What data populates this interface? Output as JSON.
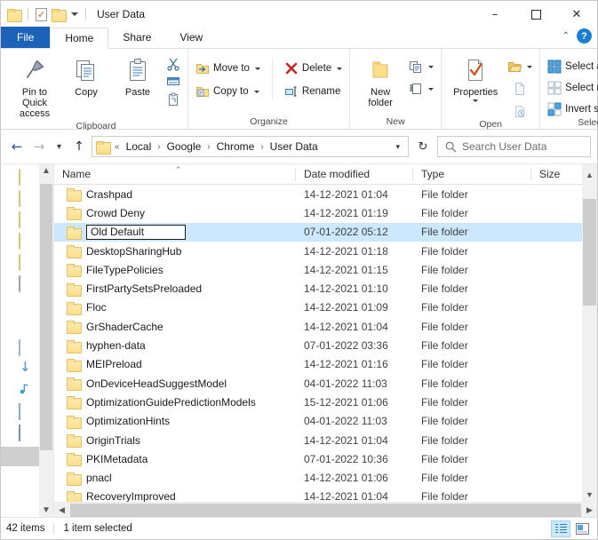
{
  "window": {
    "title": "User Data",
    "minimize_label": "–",
    "maximize_label": "☐",
    "close_label": "✕"
  },
  "quick_access_toolbar": {
    "items": [
      {
        "icon": "folder-icon",
        "name": "explorer-window-icon"
      },
      {
        "icon": "properties-icon",
        "name": "qat-properties"
      },
      {
        "icon": "new-folder-icon",
        "name": "qat-new-folder"
      }
    ],
    "customize_caret": "▾"
  },
  "tabs": {
    "file": "File",
    "items": [
      "Home",
      "Share",
      "View"
    ],
    "active": "Home",
    "collapse_ribbon": "⌃",
    "help": "?"
  },
  "ribbon": {
    "groups": [
      {
        "label": "Clipboard",
        "big_buttons": [
          {
            "label": "Pin to Quick\naccess",
            "line1": "Pin to Quick",
            "line2": "access",
            "icon": "pin-icon"
          },
          {
            "label": "Copy",
            "icon": "copy-icon"
          },
          {
            "label": "Paste",
            "icon": "paste-icon"
          }
        ],
        "small_buttons": [
          {
            "label": "",
            "icon": "cut-scissors-icon"
          },
          {
            "label": "",
            "icon": "copy-path-icon"
          },
          {
            "label": "",
            "icon": "paste-shortcut-icon"
          }
        ]
      },
      {
        "label": "Organize",
        "small_buttons": [
          {
            "label": "Move to",
            "icon": "move-to-icon",
            "caret": true
          },
          {
            "label": "Copy to",
            "icon": "copy-to-icon",
            "caret": true
          },
          {
            "label": "Delete",
            "icon": "delete-x-icon",
            "caret": true
          },
          {
            "label": "Rename",
            "icon": "rename-icon",
            "caret": false
          }
        ]
      },
      {
        "label": "New",
        "big_buttons": [
          {
            "line1": "New",
            "line2": "folder",
            "icon": "new-folder-icon"
          }
        ],
        "small_buttons": [
          {
            "label": "",
            "icon": "new-item-icon",
            "caret": true
          },
          {
            "label": "",
            "icon": "easy-access-icon",
            "caret": true
          }
        ]
      },
      {
        "label": "Open",
        "big_buttons": [
          {
            "line1": "Properties",
            "line2": "",
            "icon": "properties-icon",
            "caret": true
          }
        ],
        "small_buttons": [
          {
            "label": "",
            "icon": "open-folder-icon",
            "caret": true
          },
          {
            "label": "",
            "icon": "edit-icon"
          },
          {
            "label": "",
            "icon": "history-icon"
          }
        ]
      },
      {
        "label": "Select",
        "small_buttons": [
          {
            "label": "Select all",
            "icon": "select-all-icon"
          },
          {
            "label": "Select none",
            "icon": "select-none-icon"
          },
          {
            "label": "Invert selection",
            "icon": "invert-selection-icon"
          }
        ]
      }
    ]
  },
  "navigation": {
    "back": "←",
    "forward": "→",
    "recent_caret": "⌵",
    "up": "↑",
    "refresh": "↻",
    "breadcrumb_prefix": "«",
    "breadcrumbs": [
      "Local",
      "Google",
      "Chrome",
      "User Data"
    ],
    "breadcrumb_sep": "›",
    "path_dropdown": "⌵"
  },
  "search": {
    "placeholder": "Search User Data",
    "icon": "search-icon"
  },
  "columns": [
    {
      "key": "name",
      "label": "Name",
      "sorted": true,
      "sort_mark": "⌃"
    },
    {
      "key": "date",
      "label": "Date modified"
    },
    {
      "key": "type",
      "label": "Type"
    },
    {
      "key": "size",
      "label": "Size"
    }
  ],
  "files": [
    {
      "name": "Crashpad",
      "date": "14-12-2021 01:04",
      "type": "File folder",
      "size": ""
    },
    {
      "name": "Crowd Deny",
      "date": "14-12-2021 01:19",
      "type": "File folder",
      "size": ""
    },
    {
      "name": "Old Default",
      "date": "07-01-2022 05:12",
      "type": "File folder",
      "size": "",
      "selected": true,
      "renaming": true
    },
    {
      "name": "DesktopSharingHub",
      "date": "14-12-2021 01:18",
      "type": "File folder",
      "size": ""
    },
    {
      "name": "FileTypePolicies",
      "date": "14-12-2021 01:15",
      "type": "File folder",
      "size": ""
    },
    {
      "name": "FirstPartySetsPreloaded",
      "date": "14-12-2021 01:10",
      "type": "File folder",
      "size": ""
    },
    {
      "name": "Floc",
      "date": "14-12-2021 01:09",
      "type": "File folder",
      "size": ""
    },
    {
      "name": "GrShaderCache",
      "date": "14-12-2021 01:04",
      "type": "File folder",
      "size": ""
    },
    {
      "name": "hyphen-data",
      "date": "07-01-2022 03:36",
      "type": "File folder",
      "size": ""
    },
    {
      "name": "MEIPreload",
      "date": "14-12-2021 01:16",
      "type": "File folder",
      "size": ""
    },
    {
      "name": "OnDeviceHeadSuggestModel",
      "date": "04-01-2022 11:03",
      "type": "File folder",
      "size": ""
    },
    {
      "name": "OptimizationGuidePredictionModels",
      "date": "15-12-2021 01:06",
      "type": "File folder",
      "size": ""
    },
    {
      "name": "OptimizationHints",
      "date": "04-01-2022 11:03",
      "type": "File folder",
      "size": ""
    },
    {
      "name": "OriginTrials",
      "date": "14-12-2021 01:04",
      "type": "File folder",
      "size": ""
    },
    {
      "name": "PKIMetadata",
      "date": "07-01-2022 10:36",
      "type": "File folder",
      "size": ""
    },
    {
      "name": "pnacl",
      "date": "14-12-2021 01:06",
      "type": "File folder",
      "size": ""
    },
    {
      "name": "RecoveryImproved",
      "date": "14-12-2021 01:04",
      "type": "File folder",
      "size": ""
    }
  ],
  "rename_field": {
    "value": "Old Default"
  },
  "statusbar": {
    "item_count": "42 items",
    "selection": "1 item selected",
    "details_view": "details-view-icon",
    "large_icons_view": "large-icons-view-icon"
  },
  "colors": {
    "accent": "#1c62b9",
    "selection": "#cce8ff",
    "folder": "#fbdf8a",
    "help": "#1a7fd4"
  }
}
